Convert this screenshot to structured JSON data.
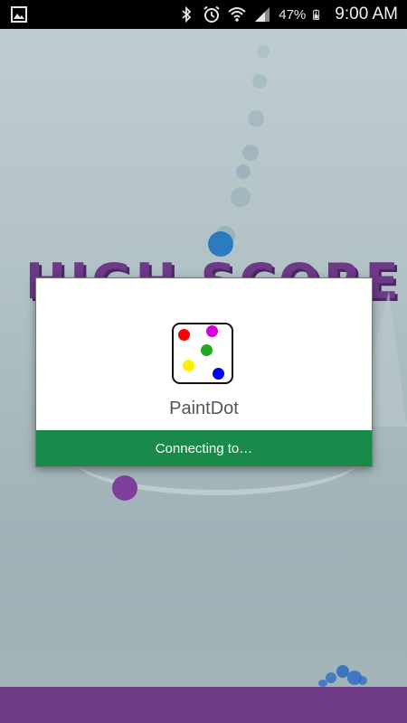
{
  "status_bar": {
    "battery_percent": "47%",
    "time": "9:00 AM",
    "icons": [
      "image-icon",
      "bluetooth-icon",
      "alarm-icon",
      "wifi-icon",
      "signal-icon",
      "battery-icon"
    ]
  },
  "game": {
    "banner_text": "HIGH SCORE"
  },
  "dialog": {
    "app_name": "PaintDot",
    "status_text": "Connecting to…",
    "logo_dot_colors": [
      "#ff0000",
      "#d400d4",
      "#1faa1f",
      "#ffee00",
      "#0000ee"
    ]
  },
  "colors": {
    "connect_bar": "#1a8a4a",
    "bottom_bar": "#6e3c87",
    "banner": "#6c3a86"
  }
}
